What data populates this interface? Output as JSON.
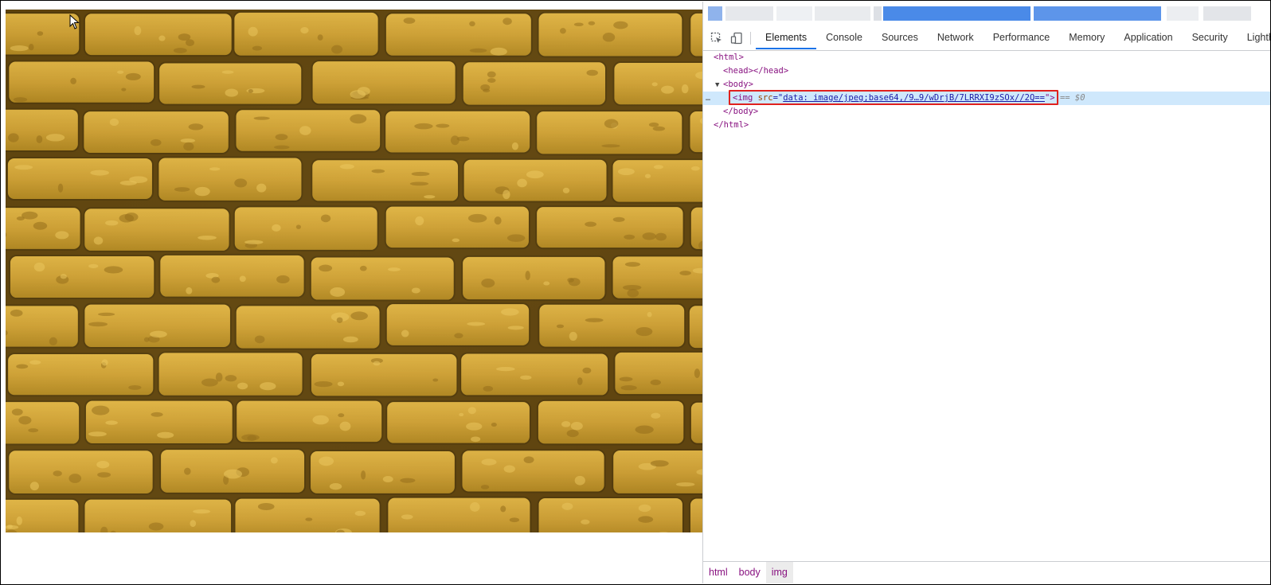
{
  "viewport": {
    "image_description_icon": "brick-wall-image",
    "colors": {
      "brick": "#c89b2c",
      "mortar": "#5a3f0e"
    }
  },
  "devtools": {
    "toolbar": {
      "inspect_icon": "inspect-element-icon",
      "device_icon": "device-toggle-icon",
      "tabs": [
        {
          "label": "Elements",
          "active": true
        },
        {
          "label": "Console"
        },
        {
          "label": "Sources"
        },
        {
          "label": "Network"
        },
        {
          "label": "Performance"
        },
        {
          "label": "Memory"
        },
        {
          "label": "Application"
        },
        {
          "label": "Security"
        },
        {
          "label": "Lighthou"
        }
      ]
    },
    "dom": {
      "html_open": "<html>",
      "head": "<head></head>",
      "body_open": "<body>",
      "img_prefix": "<img ",
      "img_attr": "src",
      "img_eq": "=\"",
      "img_src": "data: image/jpeg;base64,/9…9/wDrjB/7LRRXI9zSOx//2Q==",
      "img_suffix": "\">",
      "selected_marker": "== $0",
      "dots": "…",
      "body_close": "</body>",
      "html_close": "</html>"
    },
    "breadcrumb": [
      {
        "label": "html"
      },
      {
        "label": "body"
      },
      {
        "label": "img",
        "active": true
      }
    ],
    "accent_color": "#1a73e8",
    "highlight_color": "#e0211d"
  }
}
